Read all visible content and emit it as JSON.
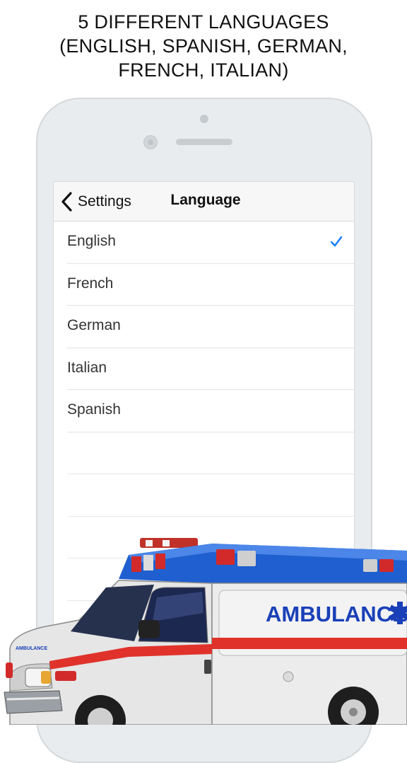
{
  "headline": {
    "line1": "5 DIFFERENT LANGUAGES",
    "line2": "(ENGLISH, SPANISH, GERMAN,",
    "line3": "FRENCH, ITALIAN)"
  },
  "navbar": {
    "back_label": "Settings",
    "title": "Language"
  },
  "languages": [
    {
      "label": "English",
      "selected": true
    },
    {
      "label": "French",
      "selected": false
    },
    {
      "label": "German",
      "selected": false
    },
    {
      "label": "Italian",
      "selected": false
    },
    {
      "label": "Spanish",
      "selected": false
    }
  ],
  "ambulance": {
    "text": "AMBULANCE",
    "side_text": "AMBULANCE"
  },
  "colors": {
    "accent": "#157efb",
    "ambulance_blue": "#1a4fc4",
    "ambulance_red": "#e0322b"
  }
}
